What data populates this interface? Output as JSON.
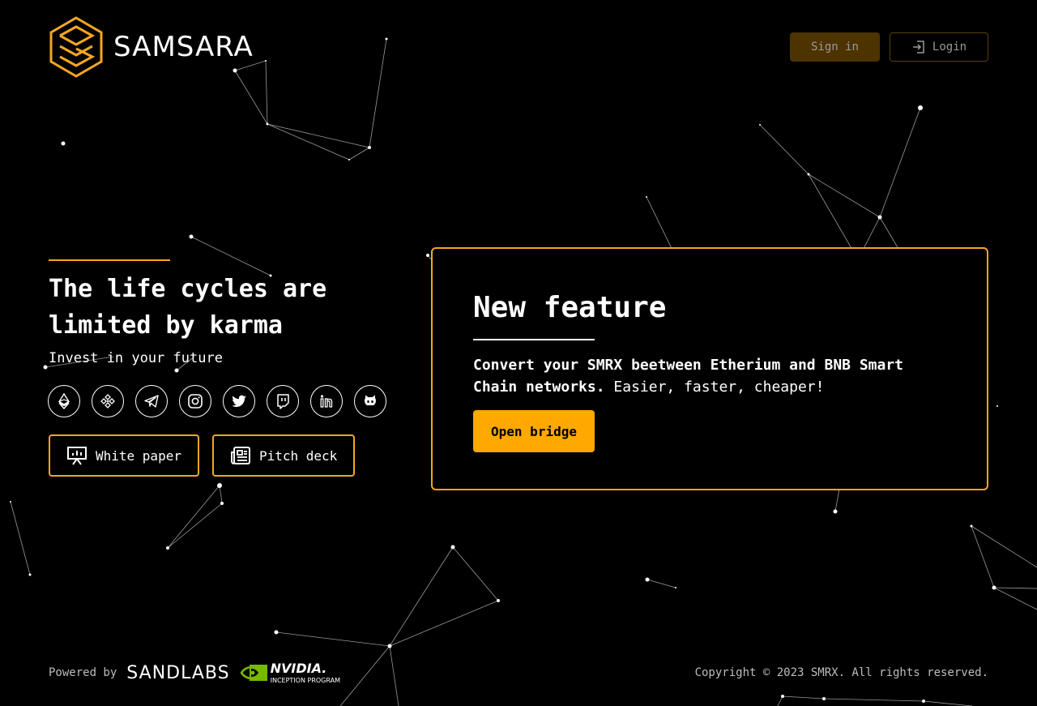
{
  "brand": {
    "name": "SAMSARA",
    "accent": "#f5a623"
  },
  "header": {
    "signin_label": "Sign in",
    "login_label": "Login",
    "login_icon": "login-icon"
  },
  "hero": {
    "title": "The life cycles are limited by karma",
    "subtitle": "Invest in your future"
  },
  "socials": [
    {
      "name": "ethereum-icon"
    },
    {
      "name": "binance-icon"
    },
    {
      "name": "telegram-icon"
    },
    {
      "name": "instagram-icon"
    },
    {
      "name": "twitter-icon"
    },
    {
      "name": "twitch-icon"
    },
    {
      "name": "linkedin-icon"
    },
    {
      "name": "github-icon"
    }
  ],
  "docs": {
    "whitepaper_label": "White paper",
    "pitchdeck_label": "Pitch deck"
  },
  "feature": {
    "title": "New feature",
    "text_bold": "Convert your SMRX beetween Etherium and BNB Smart Chain networks.",
    "text_rest": " Easier, faster, cheaper!",
    "button_label": "Open bridge"
  },
  "footer": {
    "powered_by": "Powered by",
    "sandlabs": "SANDLABS",
    "nvidia_name": "NVIDIA.",
    "nvidia_program": "INCEPTION PROGRAM",
    "copyright": "Copyright © 2023 SMRX. All rights reserved."
  }
}
